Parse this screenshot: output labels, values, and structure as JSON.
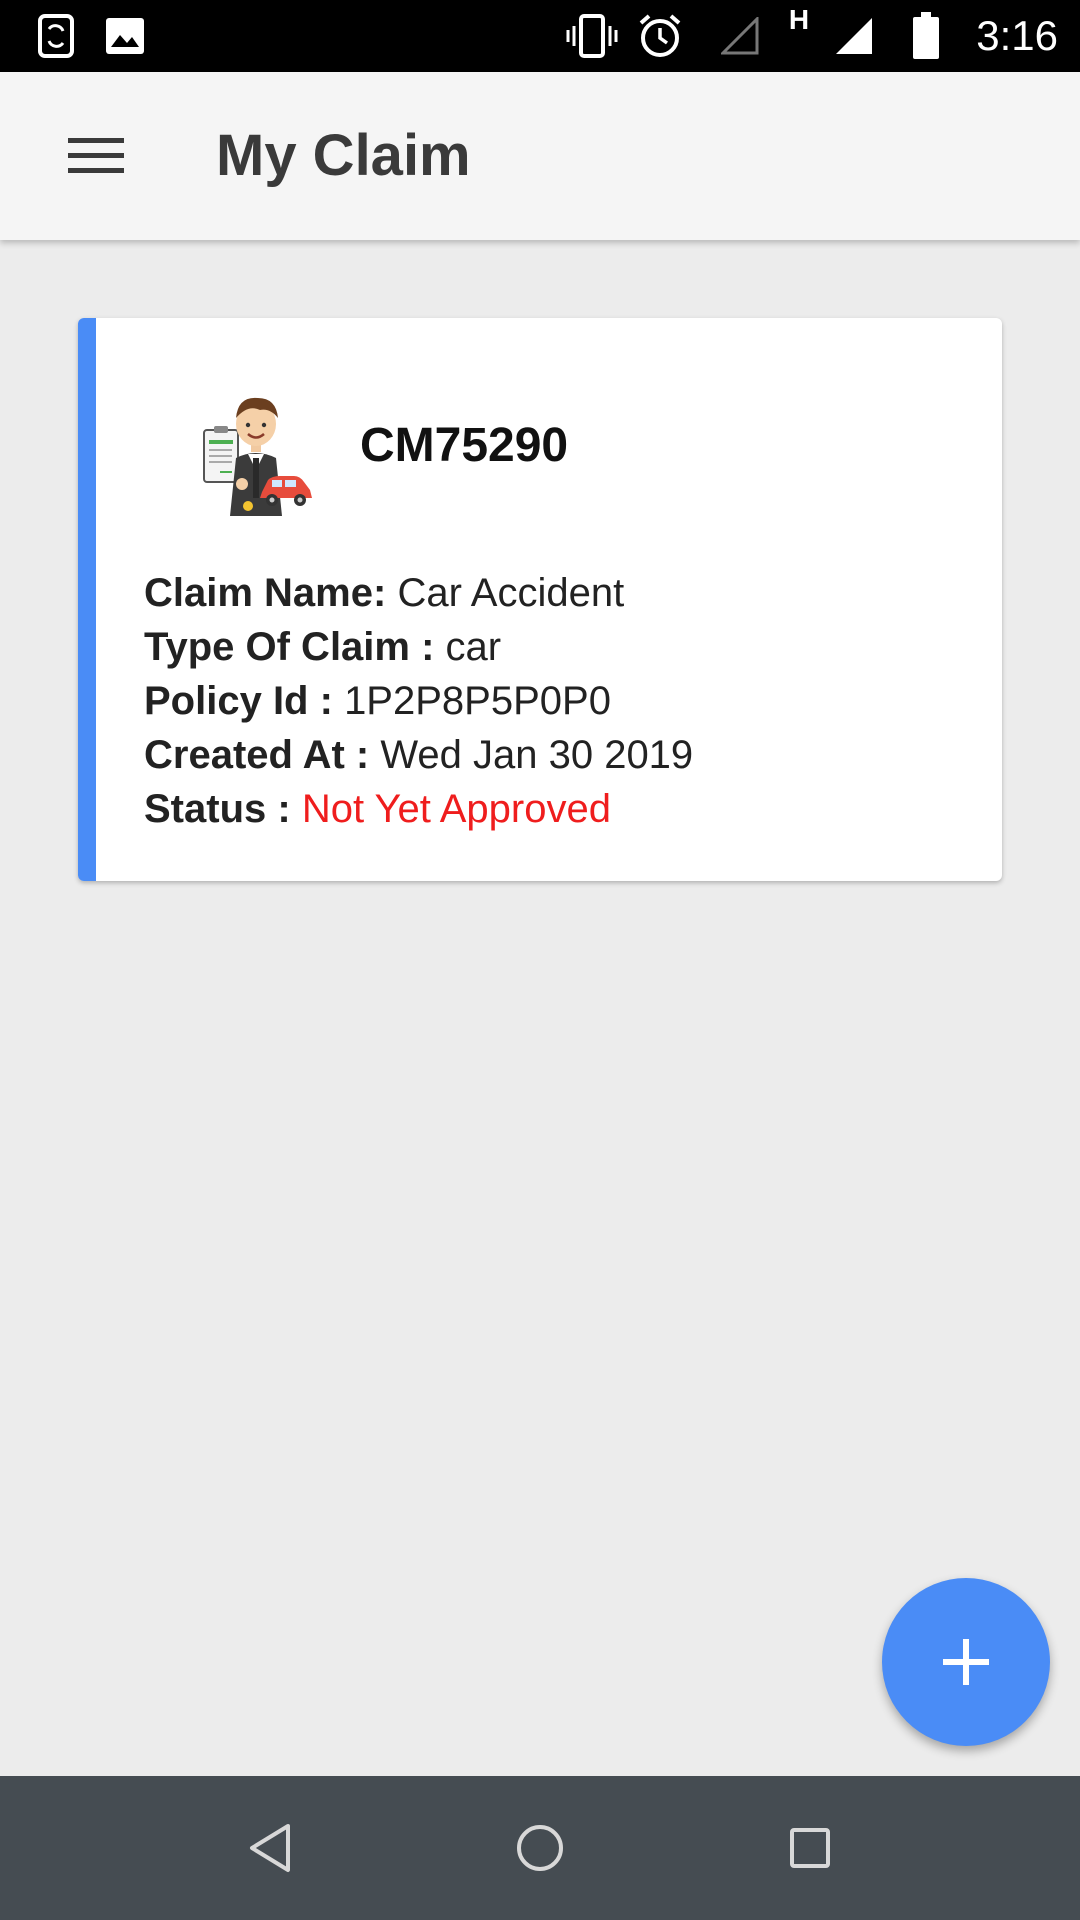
{
  "status_bar": {
    "time": "3:16",
    "network_label": "H",
    "icons": [
      "screen-rotation-icon",
      "image-icon",
      "vibrate-icon",
      "alarm-icon",
      "signal-empty-icon",
      "signal-full-icon",
      "battery-icon"
    ]
  },
  "app_bar": {
    "title": "My Claim",
    "menu_icon": "menu-icon"
  },
  "claims": [
    {
      "id": "CM75290",
      "fields": {
        "claim_name_label": "Claim Name:",
        "claim_name": "Car Accident",
        "type_label": "Type Of Claim :",
        "type": "car",
        "policy_label": "Policy Id :",
        "policy_id": "1P2P8P5P0P0",
        "created_label": "Created At :",
        "created_at": "Wed Jan 30 2019",
        "status_label": "Status :",
        "status": "Not Yet Approved"
      },
      "status_color": "#ef1d1d",
      "accent_color": "#4a8cf6"
    }
  ],
  "fab": {
    "icon": "plus-icon",
    "color": "#4a8cf6"
  },
  "nav_bar": {
    "buttons": [
      "back-icon",
      "home-icon",
      "recents-icon"
    ]
  }
}
